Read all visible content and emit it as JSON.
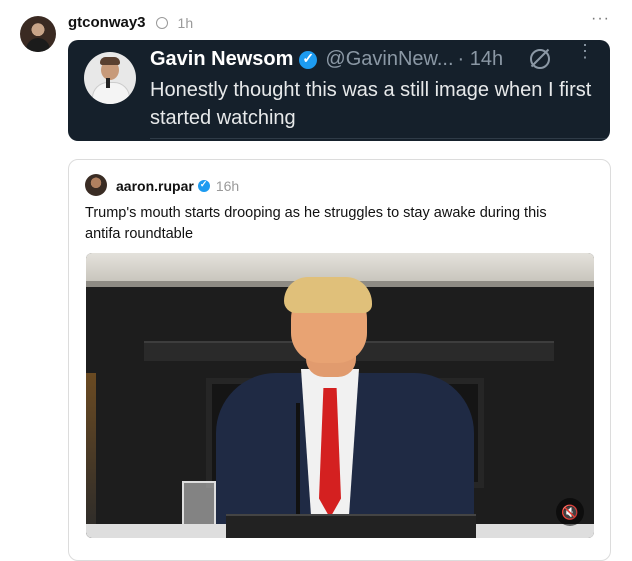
{
  "post": {
    "username": "gtconway3",
    "time": "1h",
    "more_label": "···"
  },
  "embedded_tweet": {
    "name": "Gavin Newsom",
    "handle": "@GavinNew...",
    "time": "· 14h",
    "more_label": "⋮",
    "text": "Honestly thought this was a still image when I first started watching"
  },
  "quoted_post": {
    "username": "aaron.rupar",
    "time": "16h",
    "text": "Trump's mouth starts drooping as he struggles to stay awake during this antifa roundtable",
    "video": {
      "mute_icon": "🔇"
    }
  },
  "colors": {
    "dark_card_bg": "#15202b",
    "verified_blue": "#1d9bf0",
    "muted_text": "#9a9a9a"
  },
  "icons": [
    "verified-badge-icon",
    "grok-icon",
    "more-options-icon",
    "mute-icon"
  ]
}
